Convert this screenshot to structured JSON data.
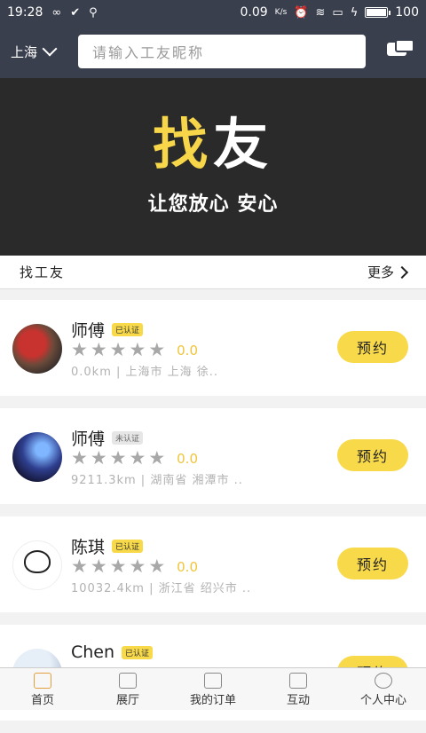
{
  "status_bar": {
    "time": "19:28",
    "net_speed": "0.09",
    "net_unit": "K/s",
    "battery": "100"
  },
  "header": {
    "city": "上海",
    "search_placeholder": "请输入工友昵称"
  },
  "banner": {
    "title_part1": "找",
    "title_part2": "友",
    "subtitle": "让您放心 安心"
  },
  "section": {
    "title": "找工友",
    "more": "更多"
  },
  "workers": [
    {
      "name": "师傅",
      "badge": "已认证",
      "verified": true,
      "score": "0.0",
      "location": "0.0km | 上海市 上海 徐..",
      "button": "预约"
    },
    {
      "name": "师傅",
      "badge": "未认证",
      "verified": false,
      "score": "0.0",
      "location": "9211.3km | 湖南省 湘潭市 ..",
      "button": "预约"
    },
    {
      "name": "陈琪",
      "badge": "已认证",
      "verified": true,
      "score": "0.0",
      "location": "10032.4km | 浙江省 绍兴市 ..",
      "button": "预约"
    },
    {
      "name": "Chen",
      "badge": "已认证",
      "verified": true,
      "score": "",
      "location": "",
      "button": "预约"
    }
  ],
  "bottom_nav": [
    {
      "label": "首页",
      "icon": "home-icon"
    },
    {
      "label": "展厅",
      "icon": "grid-icon"
    },
    {
      "label": "我的订单",
      "icon": "order-icon"
    },
    {
      "label": "互动",
      "icon": "chat-icon"
    },
    {
      "label": "个人中心",
      "icon": "person-icon"
    }
  ],
  "colors": {
    "header_bg": "#3a3f4d",
    "accent": "#f8d94a",
    "banner_bg": "#2a2a2a"
  }
}
